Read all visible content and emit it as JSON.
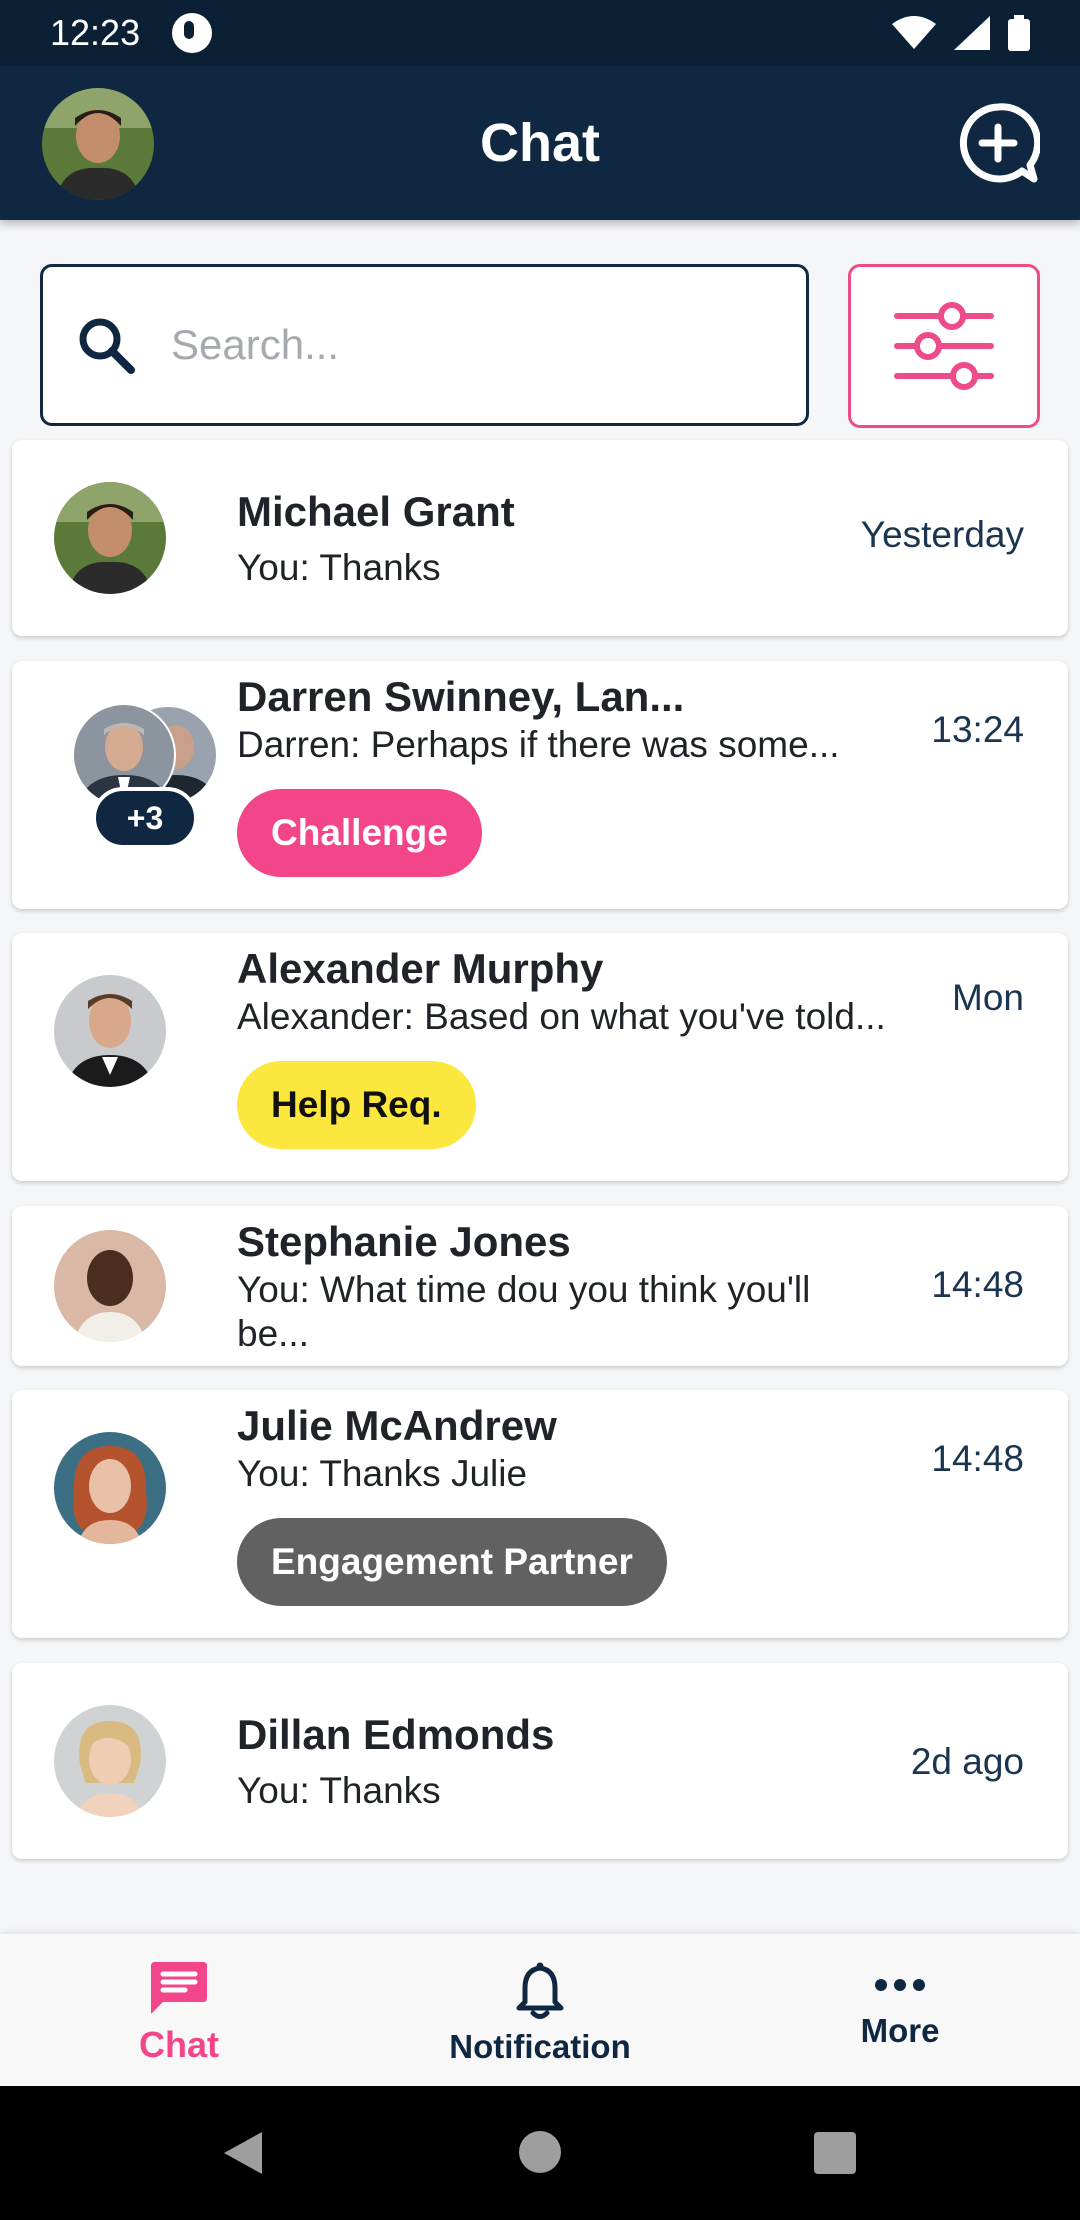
{
  "status_bar": {
    "time": "12:23"
  },
  "app_bar": {
    "title": "Chat"
  },
  "search": {
    "placeholder": "Search..."
  },
  "chats": [
    {
      "name": "Michael Grant",
      "message": "You: Thanks",
      "time": "Yesterday"
    },
    {
      "name": "Darren Swinney, Lan...",
      "message": "Darren: Perhaps if there was some...",
      "time": "13:24",
      "tag": "Challenge",
      "extra_count": "+3"
    },
    {
      "name": "Alexander Murphy",
      "message": "Alexander: Based on what you've told...",
      "time": "Mon",
      "tag": "Help Req."
    },
    {
      "name": "Stephanie Jones",
      "message": "You: What time dou you think you'll be...",
      "time": "14:48"
    },
    {
      "name": "Julie McAndrew",
      "message": "You: Thanks Julie",
      "time": "14:48",
      "tag": "Engagement Partner"
    },
    {
      "name": "Dillan Edmonds",
      "message": "You: Thanks",
      "time": "2d ago"
    }
  ],
  "bottom_nav": {
    "chat": "Chat",
    "notification": "Notification",
    "more": "More"
  },
  "colors": {
    "header": "#0f2741",
    "accent_pink": "#f3468a",
    "tag_yellow": "#fbe73d",
    "tag_gray": "#616161"
  }
}
